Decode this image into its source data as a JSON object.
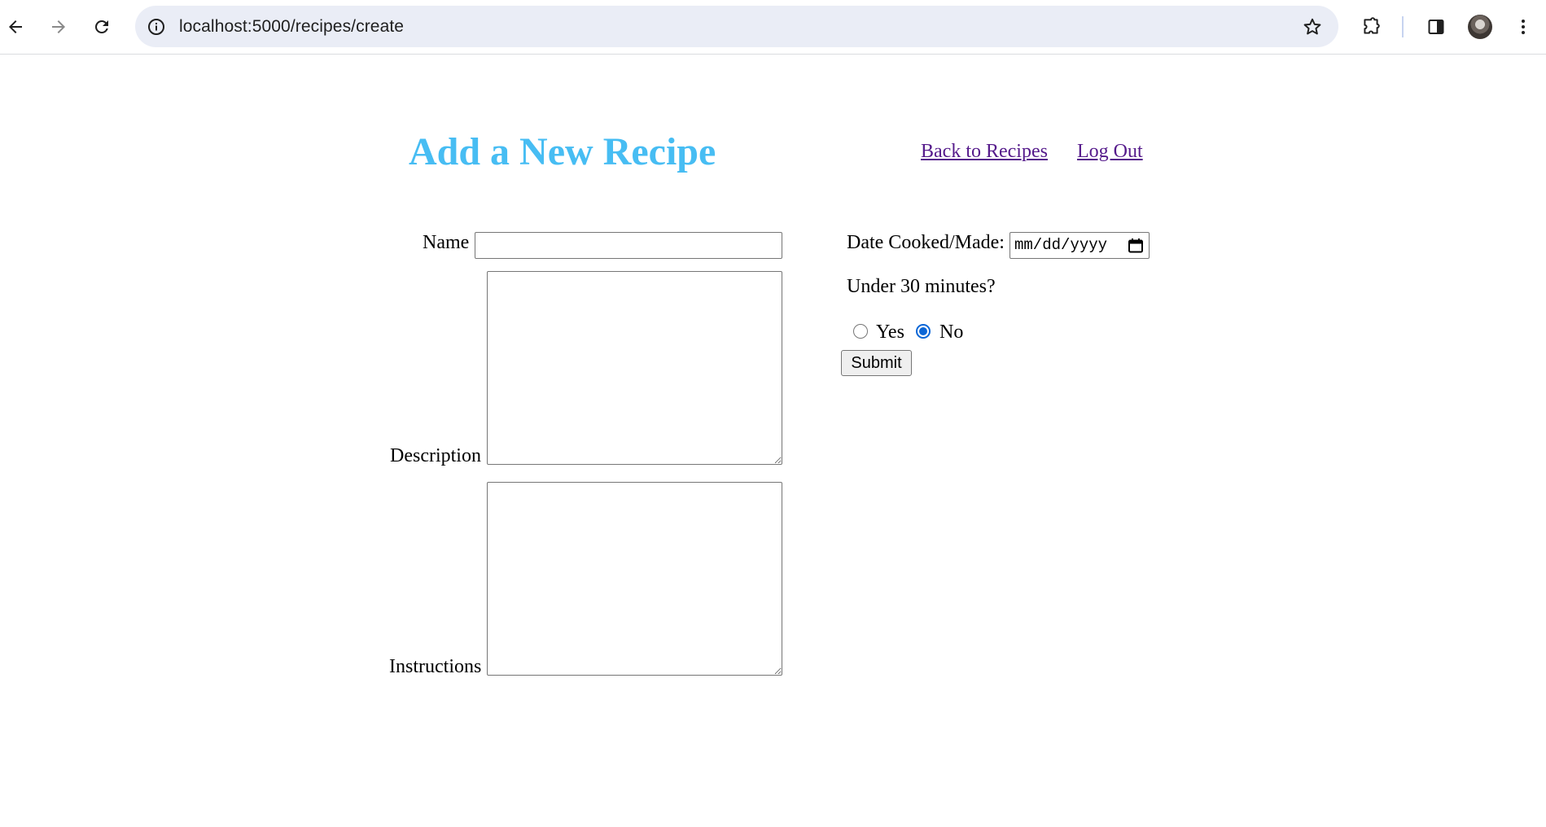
{
  "browser": {
    "url": "localhost:5000/recipes/create",
    "icons": {
      "back": "arrow-left-icon",
      "forward": "arrow-right-icon",
      "reload": "reload-icon",
      "site_info": "info-icon",
      "bookmark": "star-icon",
      "extensions": "puzzle-icon",
      "side_panel": "side-panel-icon",
      "menu": "kebab-menu-icon"
    }
  },
  "header": {
    "title": "Add a New Recipe",
    "links": {
      "back": "Back to Recipes",
      "logout": "Log Out"
    }
  },
  "form": {
    "name_label": "Name",
    "name_value": "",
    "description_label": "Description",
    "description_value": "",
    "instructions_label": "Instructions",
    "instructions_value": "",
    "date_label": "Date Cooked/Made:",
    "date_placeholder": "mm/dd/yyyy",
    "under30_label": "Under 30 minutes?",
    "under30_options": [
      {
        "label": "Yes",
        "checked": false
      },
      {
        "label": "No",
        "checked": true
      }
    ],
    "submit_label": "Submit"
  },
  "colors": {
    "title": "#47bdf3",
    "link_visited": "#551a8b",
    "radio_accent": "#0b66d6"
  }
}
